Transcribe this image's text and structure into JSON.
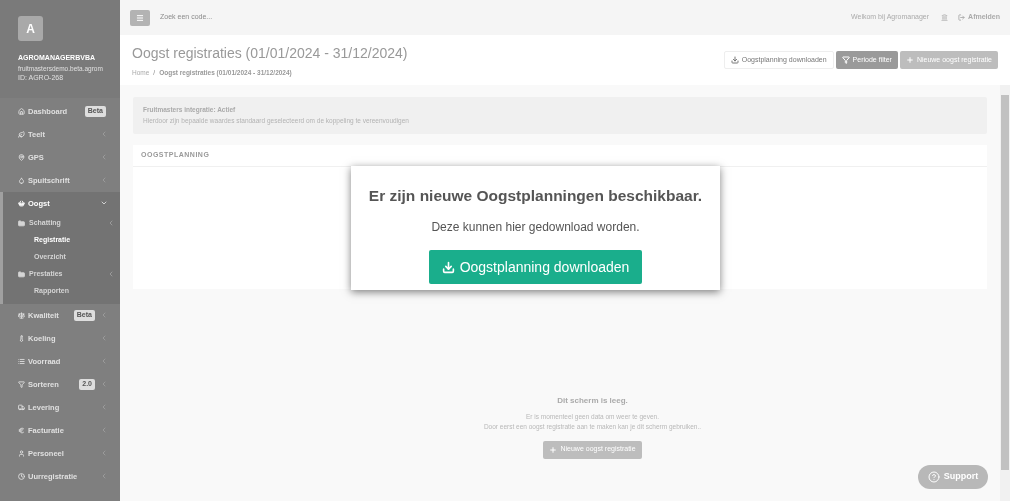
{
  "sidebar": {
    "avatar": "A",
    "company": "AGROMANAGERBVBA",
    "subtitle": "fruitmastersdemo.beta.agrom",
    "id": "ID: AGRO-268",
    "items": [
      {
        "label": "Dashboard",
        "badge": "Beta"
      },
      {
        "label": "Teelt",
        "expanded": false
      },
      {
        "label": "GPS",
        "expanded": false
      },
      {
        "label": "Spuitschrift",
        "expanded": false
      },
      {
        "label": "Oogst",
        "expanded": true,
        "children": [
          {
            "label": "Schatting",
            "kind": "folder",
            "expanded": false,
            "selected": false
          },
          {
            "label": "Registratie",
            "kind": "page",
            "selected": true
          },
          {
            "label": "Overzicht",
            "kind": "page",
            "selected": false
          },
          {
            "label": "Prestaties",
            "kind": "folder",
            "expanded": false,
            "selected": false
          },
          {
            "label": "Rapporten",
            "kind": "page",
            "selected": false
          }
        ]
      },
      {
        "label": "Kwaliteit",
        "badge": "Beta",
        "expanded": false
      },
      {
        "label": "Koeling",
        "expanded": false
      },
      {
        "label": "Voorraad",
        "expanded": false
      },
      {
        "label": "Sorteren",
        "badge": "2.0",
        "expanded": false
      },
      {
        "label": "Levering",
        "expanded": false
      },
      {
        "label": "Facturatie",
        "expanded": false
      },
      {
        "label": "Personeel",
        "expanded": false
      },
      {
        "label": "Uurregistratie",
        "expanded": false
      }
    ]
  },
  "topbar": {
    "search": {
      "placeholder": "Zoek een code..."
    },
    "welcome": "Welkom bij Agromanager",
    "logout": "Afmelden"
  },
  "header": {
    "title": "Oogst registraties (01/01/2024 - 31/12/2024)",
    "breadcrumbs": [
      "Home",
      "Oogst registraties (01/01/2024 - 31/12/2024)"
    ],
    "breadcrumb_separator": "/",
    "buttons": [
      {
        "label": "Oogstplanning downloaden",
        "kind": "download"
      },
      {
        "label": "Periode filter",
        "kind": "filter"
      },
      {
        "label": "Nieuwe oogst registratie",
        "kind": "add"
      }
    ]
  },
  "alert": {
    "title": "Fruitmasters integratie: Actief",
    "text": "Hierdoor zijn bepaalde waardes standaard geselecteerd om de koppeling te vereenvoudigen"
  },
  "panel": {
    "heading": "OOGSTPLANNING"
  },
  "empty": {
    "title": "Dit scherm is leeg.",
    "lines": [
      "Er is momenteel geen data om weer te geven.",
      "Door eerst een oogst registratie aan te maken kan je dit scherm gebruiken.."
    ],
    "button": "Nieuwe oogst registratie"
  },
  "modal": {
    "title": "Er zijn nieuwe Oogstplanningen beschikbaar.",
    "text": "Deze kunnen hier gedownload worden.",
    "button": "Oogstplanning downloaden"
  },
  "support": "Support"
}
